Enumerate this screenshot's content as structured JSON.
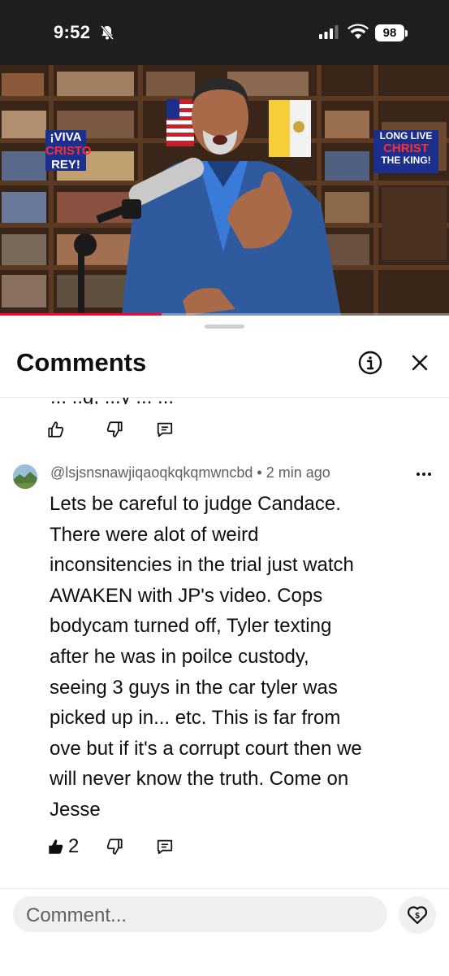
{
  "status_bar": {
    "time": "9:52",
    "battery": "98",
    "icons": [
      "bell-off-icon",
      "cellular-signal-icon",
      "wifi-icon",
      "battery-icon"
    ]
  },
  "video": {
    "banner_left": [
      "¡VIVA",
      "CRISTO",
      "REY!"
    ],
    "banner_right": [
      "LONG LIVE",
      "CHRIST",
      "THE KING!"
    ],
    "progress": 0.36,
    "accent_color": "#ff0033"
  },
  "sheet": {
    "title": "Comments",
    "info_icon": "info-icon",
    "close_icon": "close-icon"
  },
  "previous_comment": {
    "partial_text": "... ..g, ...y ... ..."
  },
  "comment": {
    "author": "@lsjsnsnawjiqaoqkqkqmwncbd",
    "separator": "•",
    "time": "2 min ago",
    "lines": [
      "Lets be careful to judge Candace.",
      "There were alot of weird",
      "inconsitencies in the trial just watch",
      "AWAKEN with JP's video. Cops",
      "bodycam turned off, Tyler texting",
      "after he was in poilce custody,",
      "seeing 3 guys in the car tyler was",
      "picked up in... etc. This is far from",
      "ove but if it's a corrupt court then we",
      "will never know the truth. Come on",
      "Jesse"
    ],
    "like_count": "2"
  },
  "composer": {
    "placeholder": "Comment..."
  }
}
